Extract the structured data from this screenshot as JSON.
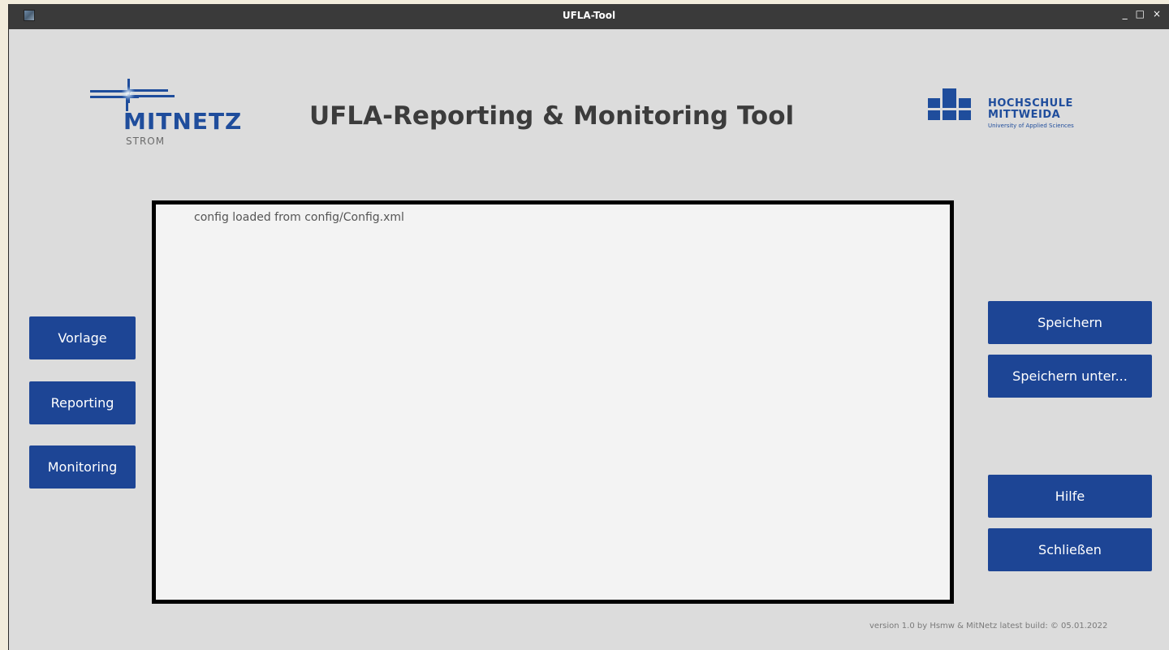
{
  "titlebar": {
    "title": "UFLA-Tool",
    "minimize": "_",
    "maximize": "□",
    "close": "×"
  },
  "header": {
    "mitnetz_word": "MITNETZ",
    "mitnetz_sub": "STROM",
    "title": "UFLA-Reporting & Monitoring Tool",
    "hsmw_line1": "HOCHSCHULE",
    "hsmw_line2": "MITTWEIDA",
    "hsmw_line3": "University of Applied Sciences"
  },
  "log": {
    "lines": [
      "config loaded from config/Config.xml"
    ]
  },
  "left_buttons": [
    {
      "label": "Vorlage"
    },
    {
      "label": "Reporting"
    },
    {
      "label": "Monitoring"
    }
  ],
  "right_buttons": [
    {
      "label": "Speichern"
    },
    {
      "label": "Speichern unter..."
    },
    {
      "label": "Hilfe"
    },
    {
      "label": "Schließen"
    }
  ],
  "footer": {
    "text": "version 1.0 by Hsmw & MitNetz latest build: © 05.01.2022"
  },
  "colors": {
    "accent": "#1d4595",
    "brand_blue": "#1f4d9c",
    "window_bg": "#dcdcdc",
    "titlebar_bg": "#3a3a3a"
  }
}
